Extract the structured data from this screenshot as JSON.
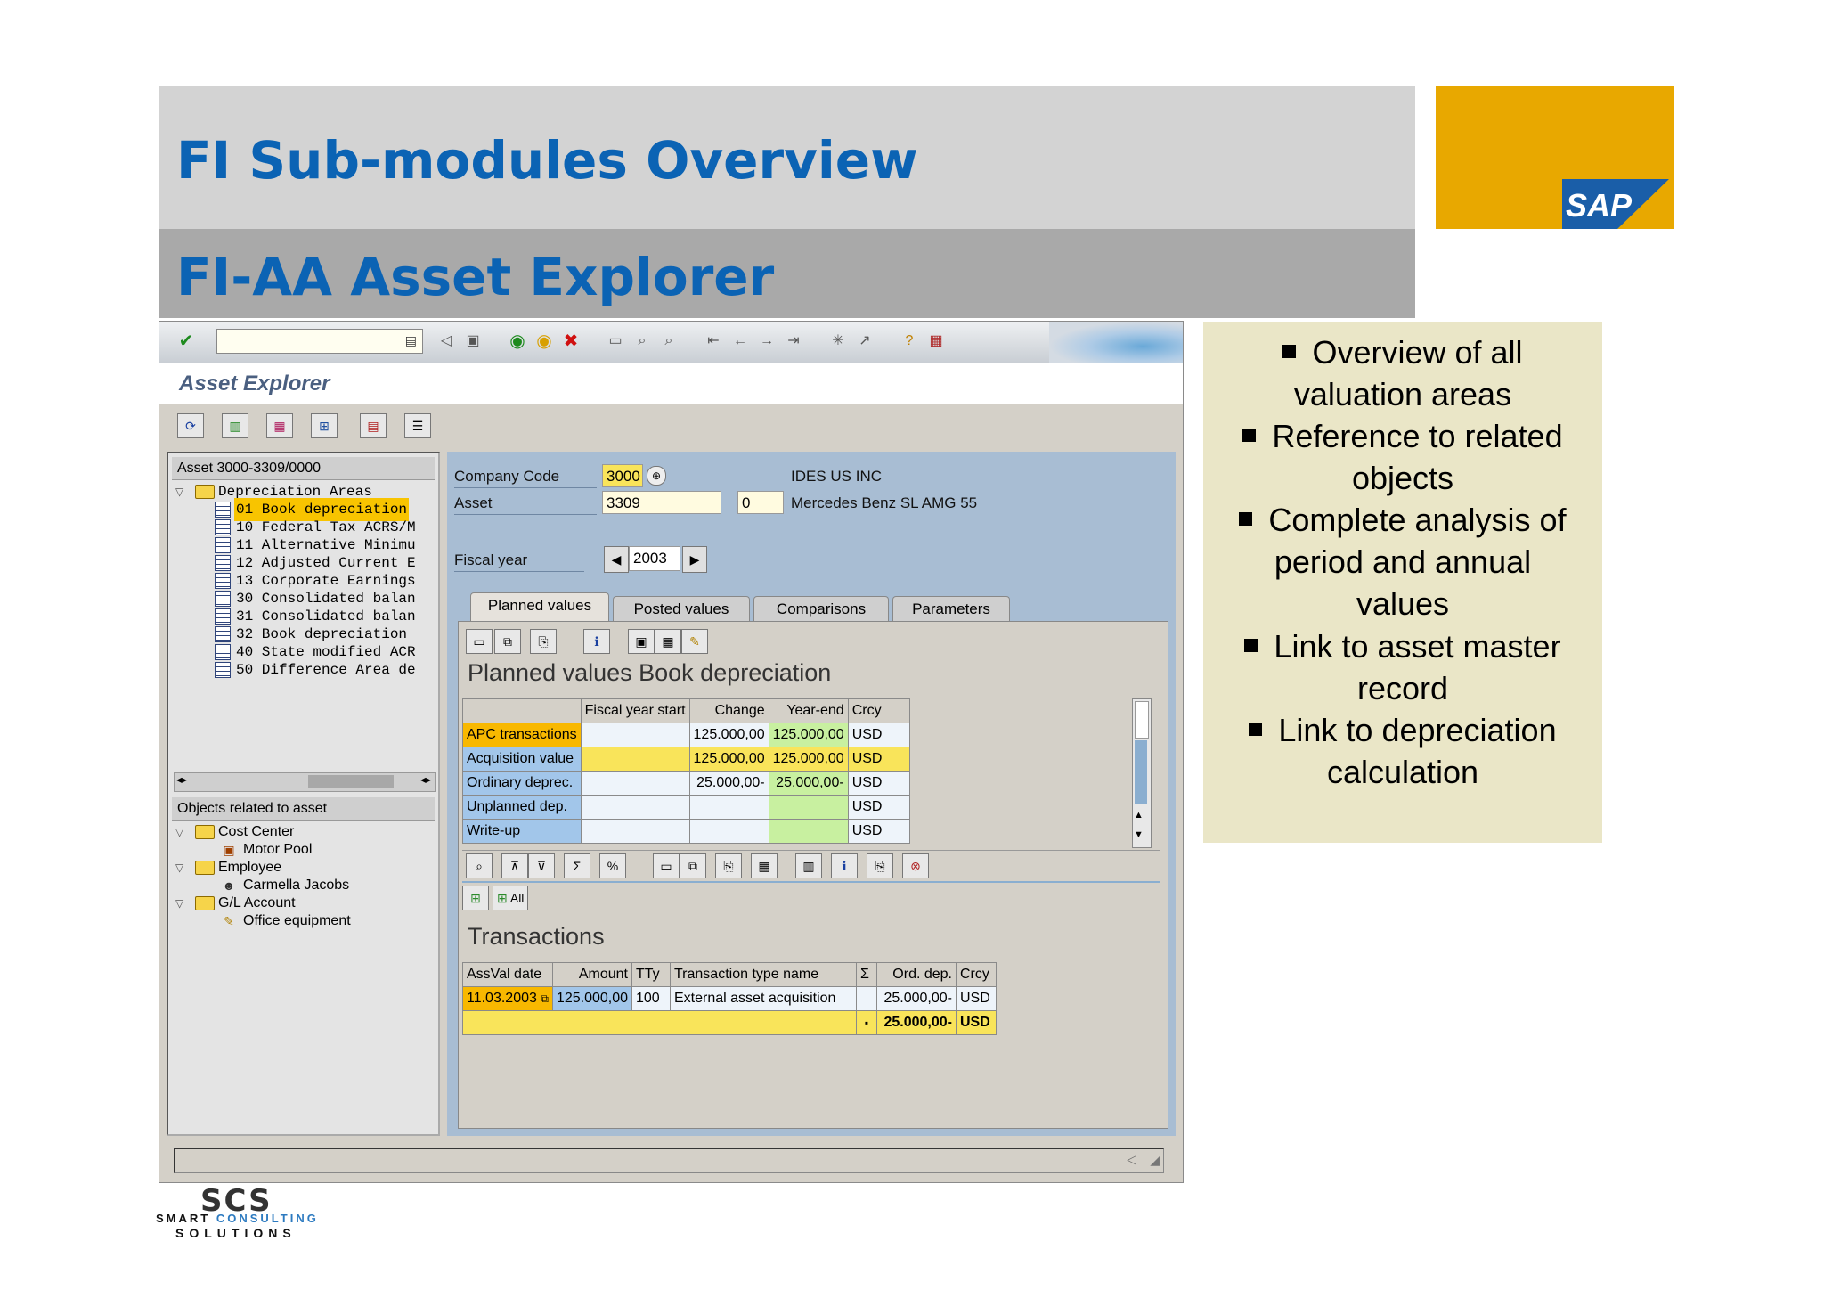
{
  "slide": {
    "title": "FI Sub-modules Overview",
    "subtitle": "FI-AA Asset Explorer"
  },
  "brand": {
    "sap_logo_text": "SAP",
    "orange": "#e8a800",
    "title_blue": "#0b63b4"
  },
  "window": {
    "title": "Asset Explorer",
    "command_field_value": ""
  },
  "tree": {
    "header": "Asset 3000-3309/0000",
    "folder_label": "Depreciation Areas",
    "areas": [
      {
        "code": "01",
        "label": "01 Book depreciation",
        "selected": true
      },
      {
        "code": "10",
        "label": "10 Federal Tax ACRS/M"
      },
      {
        "code": "11",
        "label": "11 Alternative Minimu"
      },
      {
        "code": "12",
        "label": "12 Adjusted Current E"
      },
      {
        "code": "13",
        "label": "13 Corporate Earnings"
      },
      {
        "code": "30",
        "label": "30 Consolidated balan"
      },
      {
        "code": "31",
        "label": "31 Consolidated balan"
      },
      {
        "code": "32",
        "label": "32 Book depreciation"
      },
      {
        "code": "40",
        "label": "40 State modified ACR"
      },
      {
        "code": "50",
        "label": "50 Difference Area de"
      }
    ],
    "related_header": "Objects related to asset",
    "related": [
      {
        "label": "Cost Center",
        "type": "folder"
      },
      {
        "label": "Motor Pool",
        "type": "item"
      },
      {
        "label": "Employee",
        "type": "folder"
      },
      {
        "label": "Carmella Jacobs",
        "type": "item"
      },
      {
        "label": "G/L Account",
        "type": "folder"
      },
      {
        "label": "Office equipment",
        "type": "item"
      }
    ]
  },
  "header_fields": {
    "company_code_label": "Company Code",
    "company_code_value": "3000",
    "company_name": "IDES US INC",
    "asset_label": "Asset",
    "asset_value": "3309",
    "asset_sub": "0",
    "asset_desc": "Mercedes Benz SL AMG 55",
    "fiscal_year_label": "Fiscal year",
    "fiscal_year_value": "2003"
  },
  "tabs": [
    "Planned values",
    "Posted values",
    "Comparisons",
    "Parameters"
  ],
  "planned": {
    "title": "Planned values Book depreciation",
    "columns": [
      "",
      "Fiscal year start",
      "Change",
      "Year-end",
      "Crcy"
    ],
    "rows": [
      {
        "label": "APC transactions",
        "start": "",
        "change": "125.000,00",
        "end": "125.000,00",
        "crcy": "USD"
      },
      {
        "label": "Acquisition value",
        "start": "",
        "change": "125.000,00",
        "end": "125.000,00",
        "crcy": "USD"
      },
      {
        "label": "Ordinary deprec.",
        "start": "",
        "change": "25.000,00-",
        "end": "25.000,00-",
        "crcy": "USD"
      },
      {
        "label": "Unplanned dep.",
        "start": "",
        "change": "",
        "end": "",
        "crcy": "USD"
      },
      {
        "label": "Write-up",
        "start": "",
        "change": "",
        "end": "",
        "crcy": "USD"
      }
    ]
  },
  "transactions": {
    "all_label": "All",
    "title": "Transactions",
    "columns": [
      "AssVal date",
      "Amount",
      "TTy",
      "Transaction type name",
      "Σ",
      "Ord. dep.",
      "Crcy"
    ],
    "rows": [
      {
        "date": "11.03.2003",
        "amount": "125.000,00",
        "tty": "100",
        "name": "External asset acquisition",
        "sigma": "",
        "ord": "25.000,00-",
        "crcy": "USD"
      }
    ],
    "total": {
      "marker": "▪",
      "ord": "25.000,00-",
      "crcy": "USD"
    }
  },
  "bullets": [
    [
      "Overview of all",
      "valuation areas"
    ],
    [
      "Reference to related",
      "objects"
    ],
    [
      "Complete analysis of",
      "period and annual",
      "values"
    ],
    [
      "Link to asset master",
      "record"
    ],
    [
      "Link to depreciation",
      "calculation"
    ]
  ],
  "footer": {
    "logo_big": "SCS",
    "line1_a": "SMART ",
    "line1_b": "CONSULTING",
    "line2": "SOLUTIONS"
  }
}
